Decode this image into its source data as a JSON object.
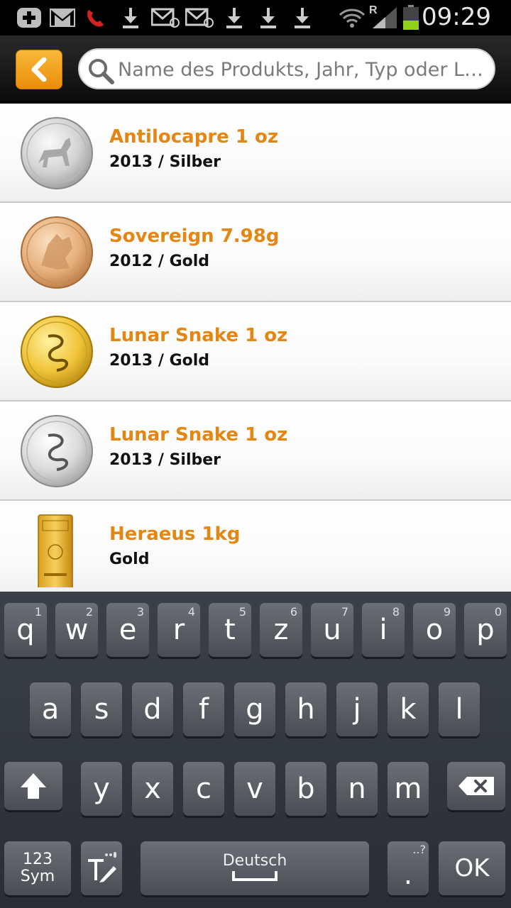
{
  "status_bar": {
    "time": "09:29",
    "roaming": "R",
    "icons": [
      "add-icon",
      "gmail-icon",
      "missed-call-icon",
      "download-icon",
      "email-icon",
      "email-icon",
      "download-icon",
      "download-icon",
      "download-icon",
      "wifi-icon",
      "signal-icon",
      "battery-icon"
    ]
  },
  "header": {
    "back_icon": "chevron-left-icon",
    "search_placeholder": "Name des Produkts, Jahr, Typ oder Lief..."
  },
  "colors": {
    "accent": "#e38612",
    "back_button": "#f5a623"
  },
  "products": [
    {
      "name": "Antilocapre 1 oz",
      "details": "2013 / Silber",
      "image": "silver-coin-antelope"
    },
    {
      "name": "Sovereign 7.98g",
      "details": "2012 / Gold",
      "image": "gold-sovereign-coin"
    },
    {
      "name": "Lunar Snake 1 oz",
      "details": "2013 / Gold",
      "image": "gold-snake-coin"
    },
    {
      "name": "Lunar Snake 1 oz",
      "details": "2013 / Silber",
      "image": "silver-snake-coin"
    },
    {
      "name": "Heraeus 1kg",
      "details": "Gold",
      "image": "gold-bar"
    }
  ],
  "keyboard": {
    "row1": [
      {
        "key": "q",
        "num": "1"
      },
      {
        "key": "w",
        "num": "2"
      },
      {
        "key": "e",
        "num": "3"
      },
      {
        "key": "r",
        "num": "4"
      },
      {
        "key": "t",
        "num": "5"
      },
      {
        "key": "z",
        "num": "6"
      },
      {
        "key": "u",
        "num": "7"
      },
      {
        "key": "i",
        "num": "8"
      },
      {
        "key": "o",
        "num": "9"
      },
      {
        "key": "p",
        "num": "0"
      }
    ],
    "row2": [
      "a",
      "s",
      "d",
      "f",
      "g",
      "h",
      "j",
      "k",
      "l"
    ],
    "row3": [
      "y",
      "x",
      "c",
      "v",
      "b",
      "n",
      "m"
    ],
    "sym_label_1": "123",
    "sym_label_2": "Sym",
    "space_label": "Deutsch",
    "period": ".",
    "period_hint": "..?",
    "ok_label": "OK"
  }
}
